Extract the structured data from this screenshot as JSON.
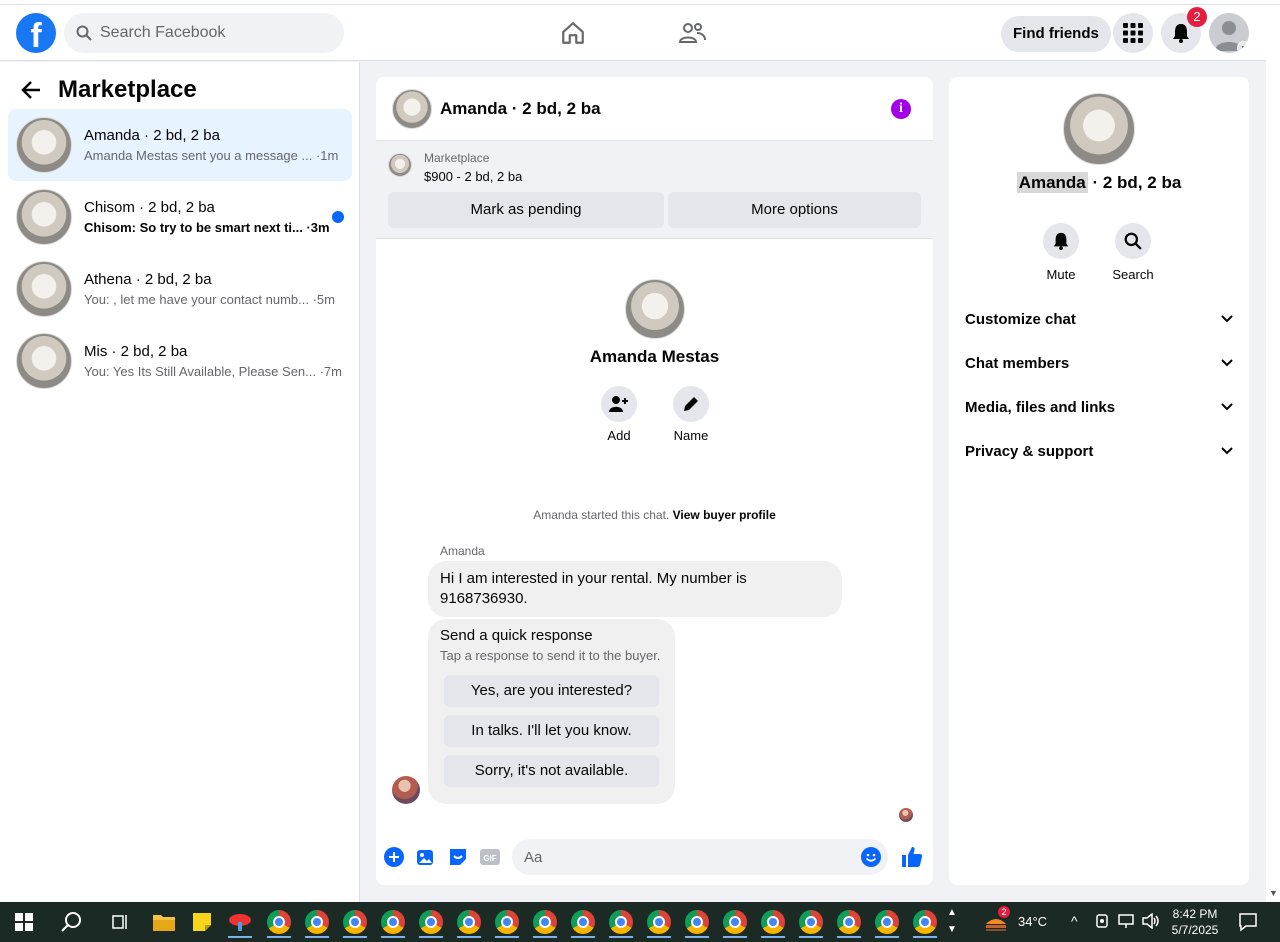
{
  "header": {
    "logo": "f",
    "search_placeholder": "Search Facebook",
    "find_friends": "Find friends",
    "notification_count": "2"
  },
  "left": {
    "title": "Marketplace",
    "conversations": [
      {
        "name": "Amanda · 2 bd, 2 ba",
        "snippet": "Amanda Mestas sent you a message ... ·1m",
        "active": true
      },
      {
        "name": "Chisom · 2 bd, 2 ba",
        "snippet": "Chisom: So try to be smart next ti... ·3m",
        "unread": true
      },
      {
        "name": "Athena · 2 bd, 2 ba",
        "snippet": "You: , let me have your contact numb... ·5m"
      },
      {
        "name": "Mis · 2 bd, 2 ba",
        "snippet": "You: Yes Its Still Available, Please Sen... ·7m"
      }
    ]
  },
  "chat": {
    "title": "Amanda · 2 bd, 2 ba",
    "listing_category": "Marketplace",
    "listing_price": "$900 - 2 bd, 2 ba",
    "mark_pending": "Mark as pending",
    "more_options": "More options",
    "profile_name": "Amanda Mestas",
    "add_label": "Add",
    "name_label": "Name",
    "started_text": "Amanda started this chat.",
    "view_buyer": "View buyer profile",
    "sender": "Amanda",
    "message": "Hi I am interested in your rental. My number is 9168736930.",
    "quick_title": "Send a quick response",
    "quick_sub": "Tap a response to send it to the buyer.",
    "quick_replies": [
      "Yes, are you interested?",
      "In talks. I'll let you know.",
      "Sorry, it's not available."
    ],
    "input_placeholder": "Aa"
  },
  "right": {
    "name_highlight": "Amanda",
    "name_rest": " · 2 bd, 2 ba",
    "mute": "Mute",
    "search": "Search",
    "sections": [
      "Customize chat",
      "Chat members",
      "Media, files and links",
      "Privacy & support"
    ]
  },
  "taskbar": {
    "weather_badge": "2",
    "temperature": "34°C",
    "time": "8:42 PM",
    "date": "5/7/2025"
  },
  "colors": {
    "brand": "#1877f2",
    "active_bg": "#e7f3ff",
    "info": "#a200e8",
    "badge": "#e41e3f"
  }
}
